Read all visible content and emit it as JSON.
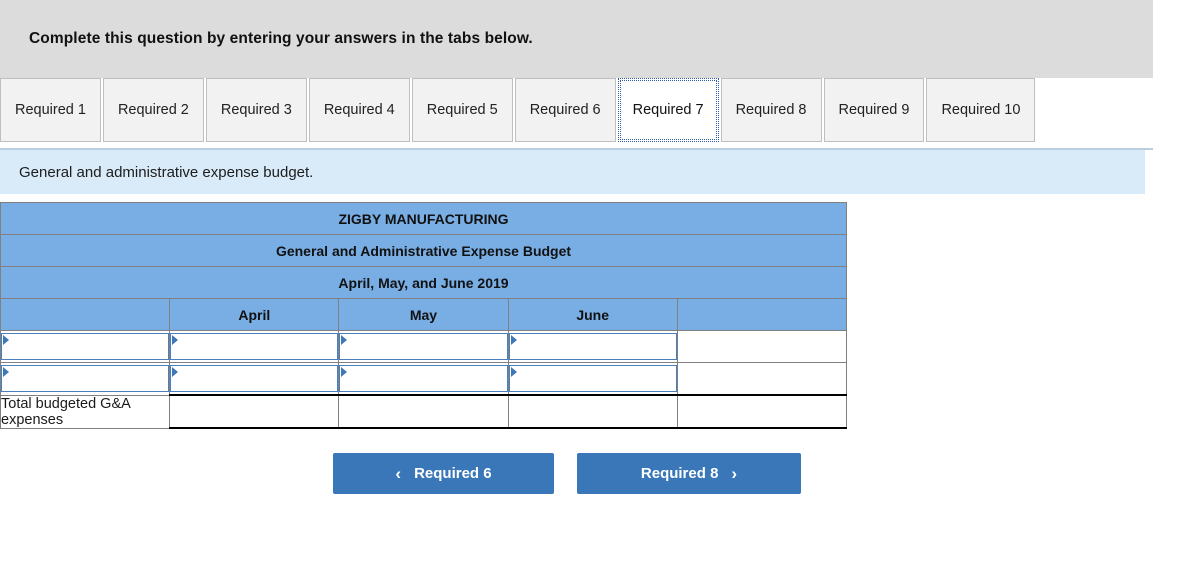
{
  "banner": {
    "instruction": "Complete this question by entering your answers in the tabs below."
  },
  "tabs": [
    {
      "label": "Required 1",
      "active": false
    },
    {
      "label": "Required 2",
      "active": false
    },
    {
      "label": "Required 3",
      "active": false
    },
    {
      "label": "Required 4",
      "active": false
    },
    {
      "label": "Required 5",
      "active": false
    },
    {
      "label": "Required 6",
      "active": false
    },
    {
      "label": "Required 7",
      "active": true
    },
    {
      "label": "Required 8",
      "active": false
    },
    {
      "label": "Required 9",
      "active": false
    },
    {
      "label": "Required 10",
      "active": false
    }
  ],
  "subbar": {
    "text": "General and administrative expense budget."
  },
  "table": {
    "title_line1": "ZIGBY MANUFACTURING",
    "title_line2": "General and Administrative Expense Budget",
    "title_line3": "April, May, and June 2019",
    "column_headers": [
      "",
      "April",
      "May",
      "June",
      ""
    ],
    "rows": [
      {
        "type": "input",
        "label": "",
        "label_value": "",
        "cells": [
          "",
          "",
          ""
        ],
        "trailing": ""
      },
      {
        "type": "input",
        "label": "",
        "label_value": "",
        "cells": [
          "",
          "",
          ""
        ],
        "trailing": ""
      },
      {
        "type": "total",
        "label": "Total budgeted G&A expenses",
        "cells": [
          "",
          "",
          ""
        ],
        "trailing": ""
      }
    ]
  },
  "nav": {
    "prev_label": "Required 6",
    "next_label": "Required 8",
    "prev_icon": "chevron-left-icon",
    "next_icon": "chevron-right-icon",
    "prev_glyph": "‹",
    "next_glyph": "›"
  },
  "colors": {
    "banner_bg": "#dcdcdc",
    "subbar_bg": "#d9ebf8",
    "table_header_blue": "#79aee4",
    "button_blue": "#3977b8",
    "input_border": "#4a7fbd"
  }
}
